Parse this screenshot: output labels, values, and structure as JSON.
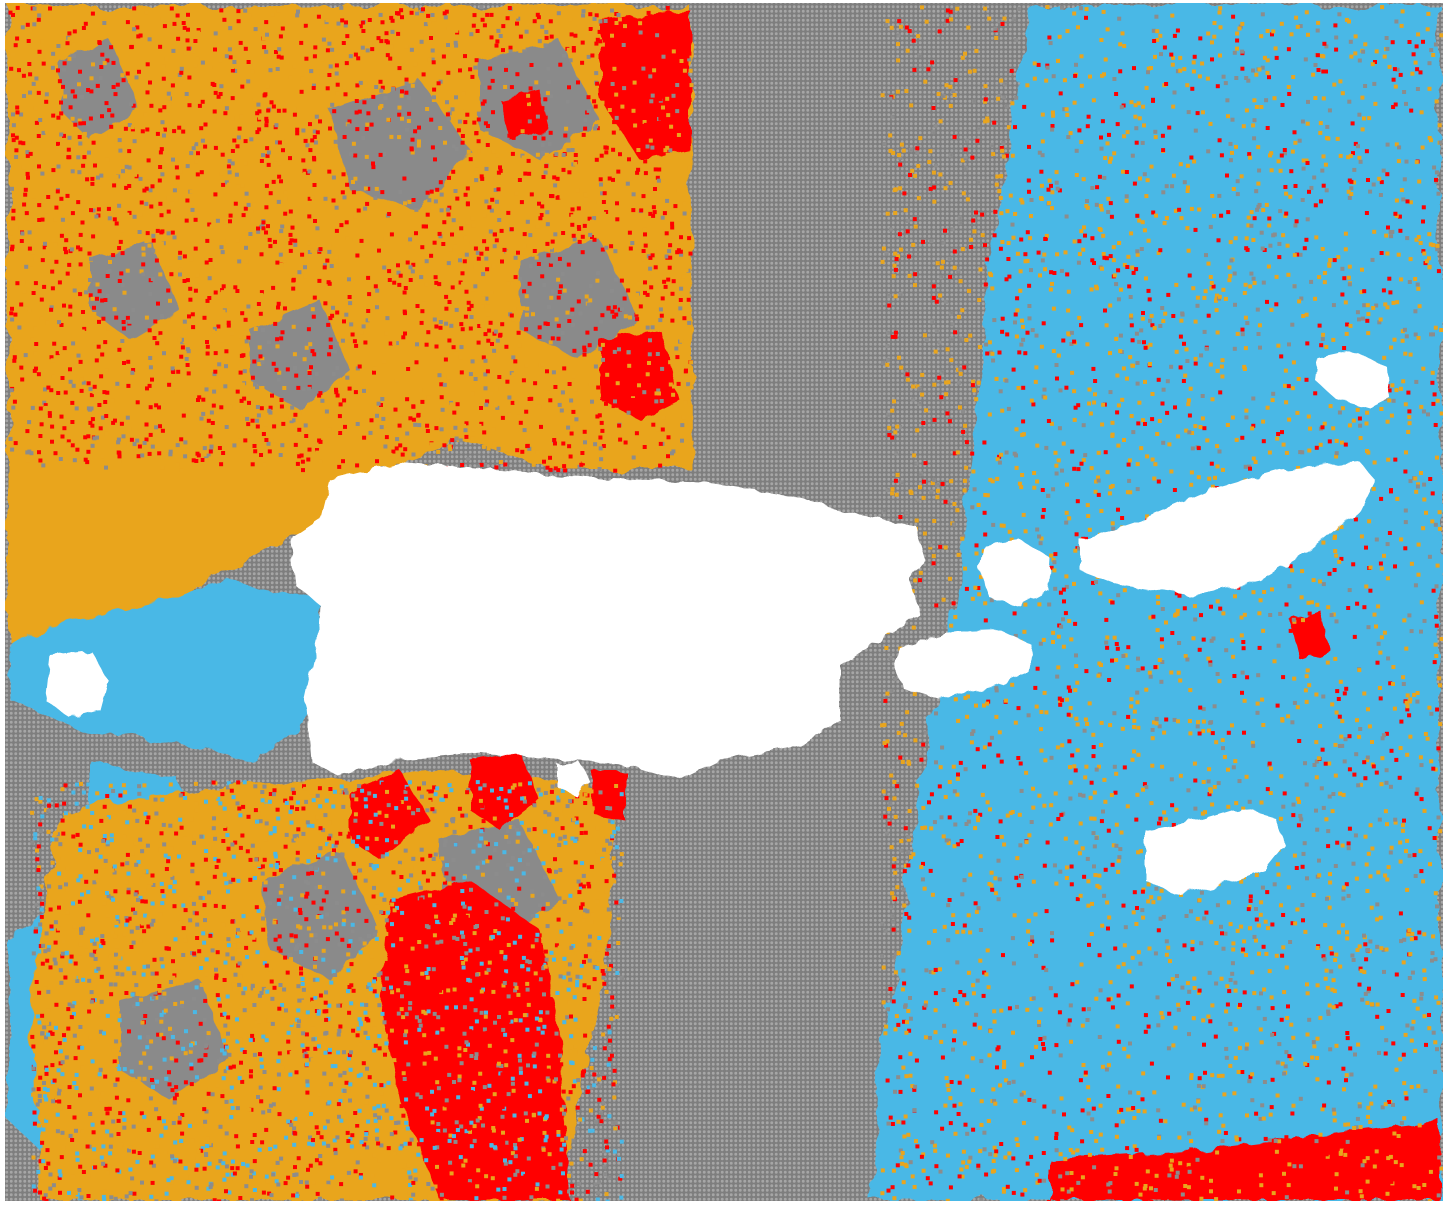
{
  "map": {
    "classes": [
      {
        "key": "no-data",
        "color": "#8c8c8c"
      },
      {
        "key": "class-blue",
        "color": "#4ab8e6"
      },
      {
        "key": "class-orange",
        "color": "#e9a51d"
      },
      {
        "key": "class-red",
        "color": "#ff0000"
      }
    ],
    "land_color": "#ffffff",
    "background": "#ffffff"
  }
}
